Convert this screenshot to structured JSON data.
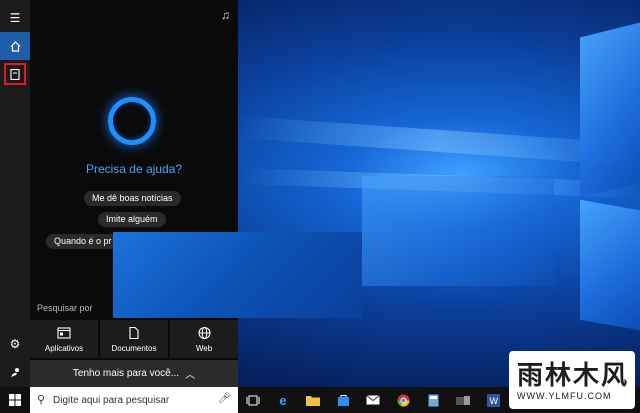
{
  "cortana": {
    "title": "Precisa de ajuda?",
    "suggestions": [
      "Me dê boas notícias",
      "Imite alguém",
      "Quando é o pr"
    ],
    "search_by_label": "Pesquisar por",
    "categories": [
      {
        "label": "Aplicativos",
        "icon": "apps-icon"
      },
      {
        "label": "Documentos",
        "icon": "document-icon"
      },
      {
        "label": "Web",
        "icon": "globe-icon"
      }
    ],
    "more_label": "Tenho mais para você..."
  },
  "taskbar": {
    "search_placeholder": "Digite aqui para pesquisar",
    "apps": [
      "task-view-icon",
      "edge-icon",
      "file-explorer-icon",
      "store-icon",
      "mail-icon",
      "chrome-icon",
      "calculator-icon",
      "teams-icon",
      "photos-icon",
      "word-icon"
    ]
  },
  "watermark": {
    "brand": "雨林木风",
    "url": "WWW.YLMFU.COM"
  },
  "colors": {
    "accent": "#1f5da8",
    "highlight_box": "#e01b1b",
    "cortana_ring": "#1f8fff",
    "help_text": "#4aa3ff"
  }
}
